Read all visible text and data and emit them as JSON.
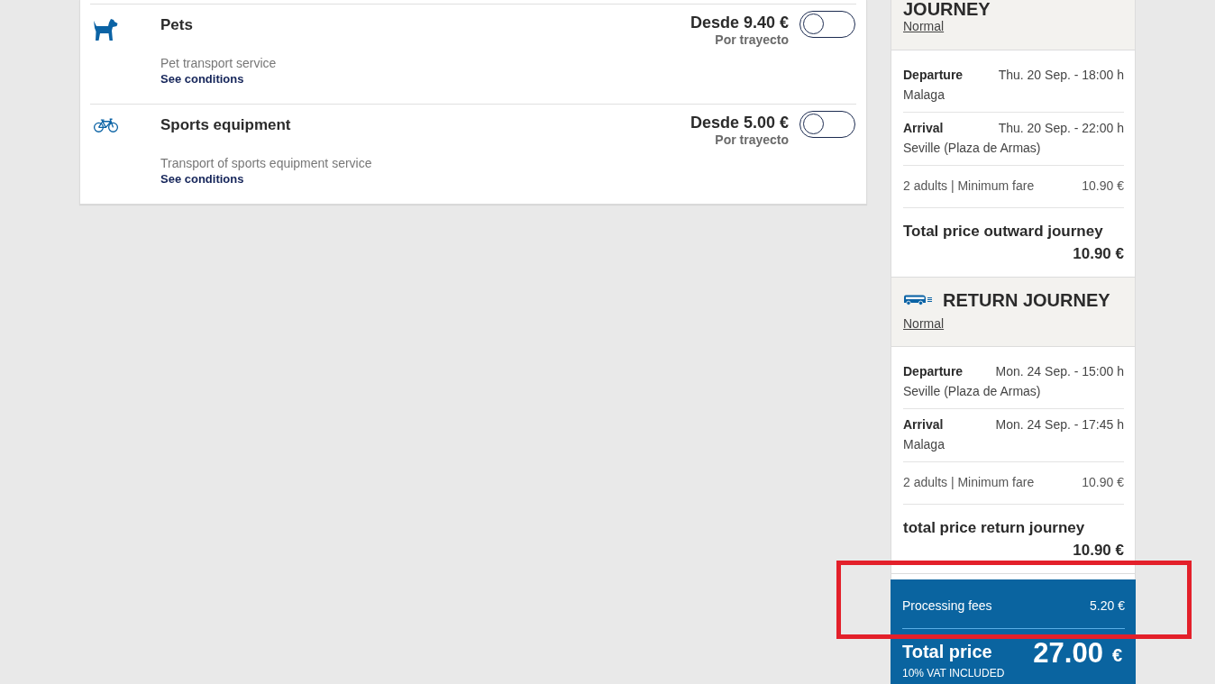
{
  "extras": [
    {
      "kind": "pet",
      "title": "Pets",
      "price": "Desde 9.40 €",
      "price_note": "Por trayecto",
      "description": "Pet transport service",
      "link": "See conditions",
      "on": false
    },
    {
      "kind": "sport",
      "title": "Sports equipment",
      "price": "Desde 5.00 €",
      "price_note": "Por trayecto",
      "description": "Transport of sports equipment service",
      "link": "See conditions",
      "on": false
    }
  ],
  "summary": {
    "journeys": [
      {
        "kind": "outward",
        "title": "JOURNEY",
        "fare_type": "Normal",
        "stops": [
          {
            "label": "Departure",
            "datetime": "Thu. 20 Sep. - 18:00 h",
            "place": "Malaga"
          },
          {
            "label": "Arrival",
            "datetime": "Thu. 20 Sep. - 22:00 h",
            "place": "Seville (Plaza de Armas)"
          }
        ],
        "fare": {
          "label": "2 adults | Minimum fare",
          "amount": "10.90 €"
        },
        "total_label": "Total price outward journey",
        "total": "10.90 €"
      },
      {
        "kind": "return",
        "title": "RETURN JOURNEY",
        "fare_type": "Normal",
        "stops": [
          {
            "label": "Departure",
            "datetime": "Mon. 24 Sep. - 15:00 h",
            "place": "Seville (Plaza de Armas)"
          },
          {
            "label": "Arrival",
            "datetime": "Mon. 24 Sep. - 17:45 h",
            "place": "Malaga"
          }
        ],
        "fare": {
          "label": "2 adults | Minimum fare",
          "amount": "10.90 €"
        },
        "total_label": "total price return journey",
        "total": "10.90 €"
      }
    ],
    "fees": {
      "label": "Processing fees",
      "amount": "5.20 €",
      "highlighted": true
    },
    "total": {
      "label": "Total price",
      "amount": "27.00",
      "currency": "€",
      "note": "10% VAT INCLUDED"
    }
  }
}
